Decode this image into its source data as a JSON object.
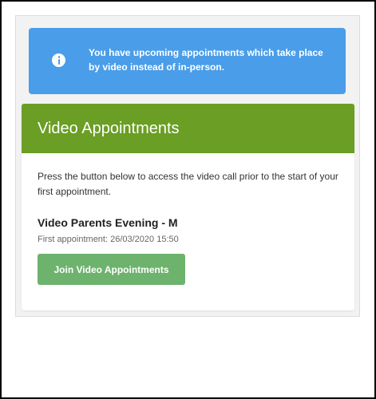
{
  "alert": {
    "icon": "info-circle-icon",
    "message": "You have upcoming appointments which take place by video instead of in-person.",
    "color": "#4a9de8"
  },
  "card": {
    "title": "Video Appointments",
    "header_color": "#6a9e24",
    "description": "Press the button below to access the video call prior to the start of your first appointment.",
    "event_name": "Video Parents Evening - M",
    "first_appointment": "First appointment: 26/03/2020 15:50",
    "join_button_label": "Join Video Appointments",
    "button_color": "#6db26d"
  }
}
